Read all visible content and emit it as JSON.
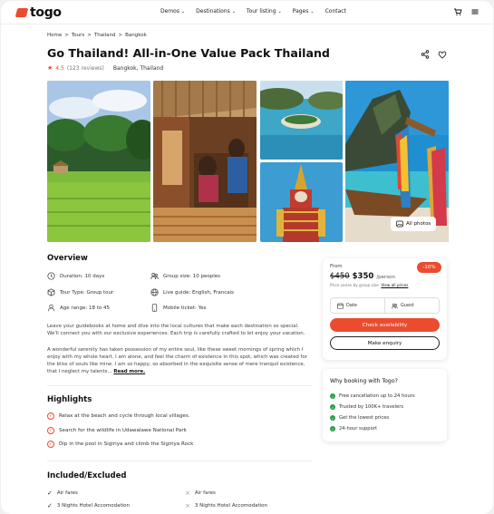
{
  "header": {
    "brand": "togo",
    "nav": [
      "Demos",
      "Destinations",
      "Tour listing",
      "Pages",
      "Contact"
    ]
  },
  "breadcrumb": [
    "Home",
    "Tours",
    "Thailand",
    "Bangkok"
  ],
  "tour": {
    "title": "Go Thailand! All-in-One Value Pack Thailand",
    "rating": "4.5",
    "reviews": "(123 reviews)",
    "location": "Bangkok, Thailand"
  },
  "gallery": {
    "all_photos_label": "All photos"
  },
  "overview": {
    "heading": "Overview",
    "features": [
      "Duration: 10 days",
      "Group size: 10 peoples",
      "Tour Type: Group tour",
      "Live guide: English, Francais",
      "Age range: 18 to 45",
      "Mobile ticket: Yes"
    ],
    "para1": "Leave your guidebooks at home and dive into the local cultures that make each destination so special. We'll connect you with our exclusive experiences. Each trip is carefully crafted to let enjoy your vacation.",
    "para2": "A wonderful serenity has taken possession of my entire soul, like these sweet mornings of spring which I enjoy with my whole heart. I am alone, and feel the charm of existence in this spot, which was created for the bliss of souls like mine. I am so happy, so absorbed in the exquisite sense of mere tranquil existence, that I neglect my talents...",
    "read_more": "Read more."
  },
  "highlights": {
    "heading": "Highlights",
    "items": [
      "Relax at the beach and cycle through local villages.",
      "Search for the wildlife in Udawalawe National Park",
      "Dip in the pool in Sigiriya and climb the Sigiriya Rock"
    ]
  },
  "included": {
    "heading": "Included/Excluded",
    "rows": [
      {
        "included": "Air fares",
        "excluded": "Air fares"
      },
      {
        "included": "3 Nights Hotel Accomodation",
        "excluded": "3 Nights Hotel Accomodation"
      }
    ]
  },
  "booking": {
    "from_label": "From",
    "old_price": "$450",
    "new_price": "$350",
    "per": "/person",
    "discount": "-10%",
    "note": "Price varies by group size.",
    "note_link": "View all prices",
    "date_label": "Date",
    "guest_label": "Guest",
    "check_label": "Check availability",
    "enquiry_label": "Make enquiry"
  },
  "why": {
    "title": "Why booking with Togo?",
    "items": [
      "Free cancellation up to 24 hours",
      "Trusted by 100K+ travelers",
      "Get the lowest prices",
      "24-hour support"
    ]
  },
  "colors": {
    "accent": "#eb4c2f",
    "success": "#2a9d4b"
  }
}
